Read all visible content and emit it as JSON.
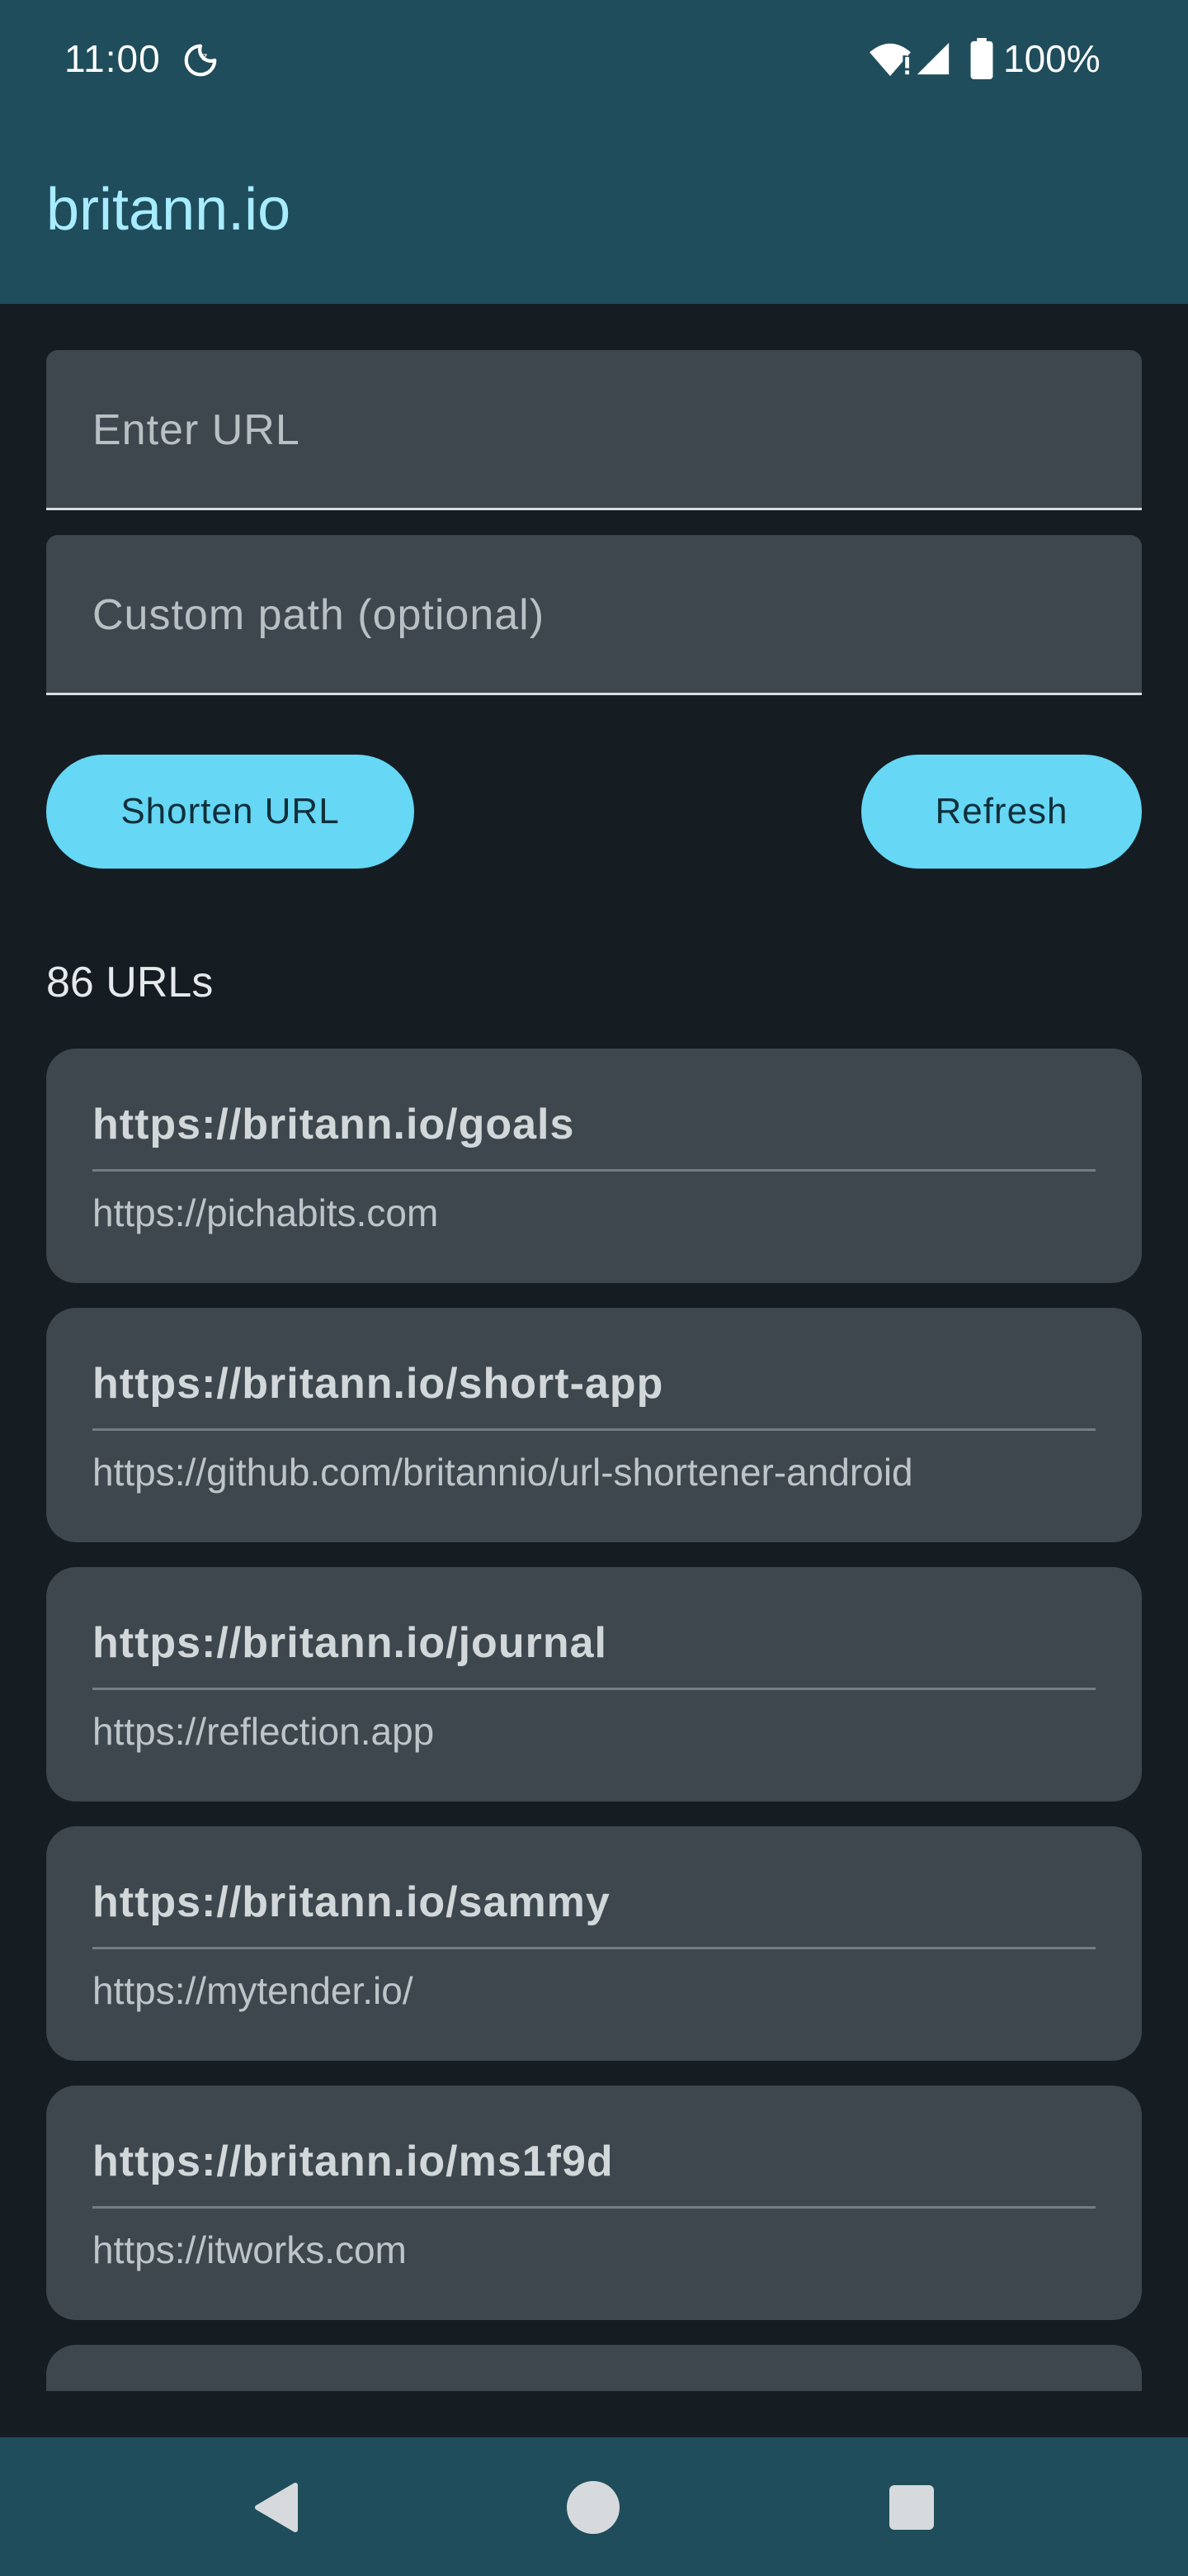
{
  "status_bar": {
    "time": "11:00",
    "battery": "100%",
    "icons": [
      "moon-icon",
      "wifi-icon",
      "signal-icon",
      "battery-icon"
    ]
  },
  "app_bar": {
    "title": "britann.io"
  },
  "form": {
    "url_placeholder": "Enter URL",
    "url_value": "",
    "path_placeholder": "Custom path (optional)",
    "path_value": "",
    "shorten_label": "Shorten URL",
    "refresh_label": "Refresh"
  },
  "list": {
    "count_label": "86 URLs",
    "items": [
      {
        "short": "https://britann.io/goals",
        "long": "https://pichabits.com"
      },
      {
        "short": "https://britann.io/short-app",
        "long": "https://github.com/britannio/url-shortener-android"
      },
      {
        "short": "https://britann.io/journal",
        "long": "https://reflection.app"
      },
      {
        "short": "https://britann.io/sammy",
        "long": "https://mytender.io/"
      },
      {
        "short": "https://britann.io/ms1f9d",
        "long": "https://itworks.com"
      },
      {
        "short": "",
        "long": ""
      }
    ]
  },
  "nav_bar": {
    "icons": [
      "back-icon",
      "home-icon",
      "recents-icon"
    ]
  },
  "colors": {
    "status_bar_bg": "#1f4d5b",
    "background": "#151d22",
    "card_bg": "#3e474e",
    "accent": "#66d7f5",
    "title_text": "#a8ecff"
  }
}
